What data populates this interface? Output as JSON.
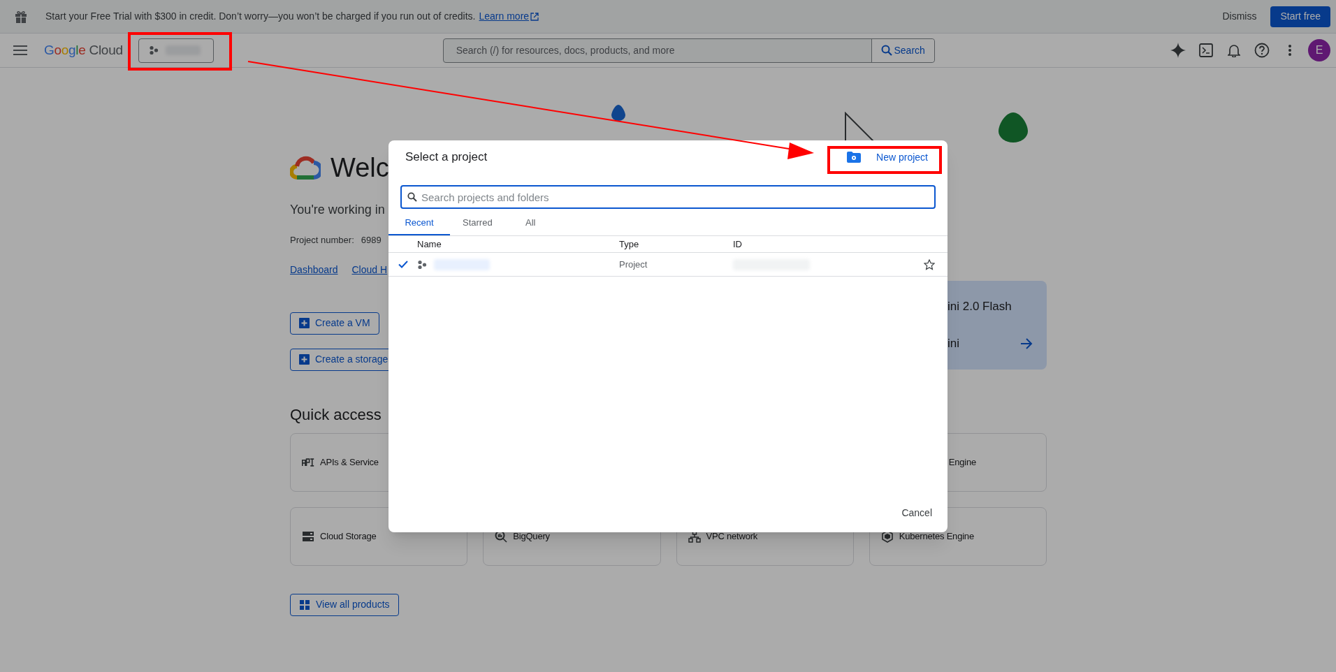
{
  "banner": {
    "message": "Start your Free Trial with $300 in credit. Don’t worry—you won’t be charged if you run out of credits.",
    "link": "Learn more",
    "dismiss": "Dismiss",
    "action": "Start free"
  },
  "header": {
    "logo": {
      "brand": "Google",
      "product": "Cloud"
    },
    "search": {
      "placeholder": "Search (/) for resources, docs, products, and more",
      "button": "Search"
    },
    "avatar": "E"
  },
  "welcome": {
    "title": "Welc",
    "working_in": "You're working in",
    "project_number_label": "Project number:",
    "project_number": "6989",
    "links": [
      "Dashboard",
      "Cloud H"
    ]
  },
  "actions": [
    "Create a VM",
    "Create a storage"
  ],
  "gemini_card": {
    "title": "ini 2.0 Flash",
    "subtitle": "ini"
  },
  "quick_access": {
    "title": "Quick access",
    "cards": [
      {
        "label": "APIs & Service",
        "kind": "api"
      },
      {
        "label": "Engine",
        "kind": "partial"
      },
      {
        "label": "Cloud Storage",
        "kind": "storage"
      },
      {
        "label": "BigQuery",
        "kind": "bigquery"
      },
      {
        "label": "VPC network",
        "kind": "vpc"
      },
      {
        "label": "Kubernetes Engine",
        "kind": "kubernetes"
      }
    ]
  },
  "view_all": "View all products",
  "dialog": {
    "title": "Select a project",
    "new_project": "New project",
    "search": {
      "placeholder": "Search projects and folders"
    },
    "tabs": [
      {
        "label": "Recent",
        "selected": true
      },
      {
        "label": "Starred",
        "selected": false
      },
      {
        "label": "All",
        "selected": false
      }
    ],
    "columns": [
      "Name",
      "Type",
      "ID"
    ],
    "rows": [
      {
        "type": "Project",
        "selected": true,
        "starred": false
      }
    ],
    "cancel": "Cancel"
  }
}
